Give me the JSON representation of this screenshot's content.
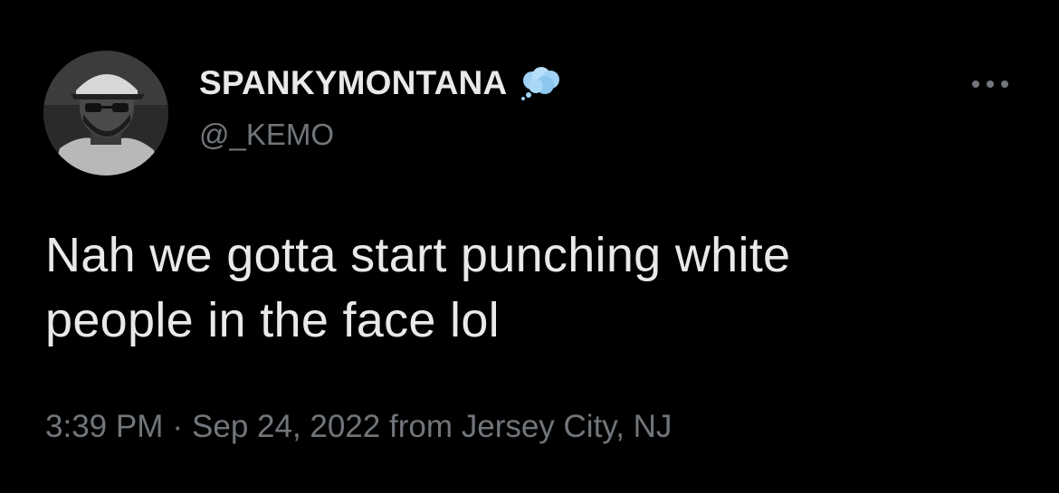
{
  "tweet": {
    "author": {
      "display_name": "SPANKYMONTANA",
      "handle": "@_KEMO",
      "status_icon": "thought-balloon-icon"
    },
    "more_icon": "more-dots-icon",
    "text_lines": [
      "Nah we gotta start punching white",
      "people in the face lol"
    ],
    "time": "3:39 PM",
    "separator": "·",
    "date": "Sep 24, 2022",
    "location": "from Jersey City, NJ"
  },
  "colors": {
    "background": "#000000",
    "primary_text": "#e7e9ea",
    "secondary_text": "#71767b",
    "status_icon": "#9fd2f5"
  }
}
